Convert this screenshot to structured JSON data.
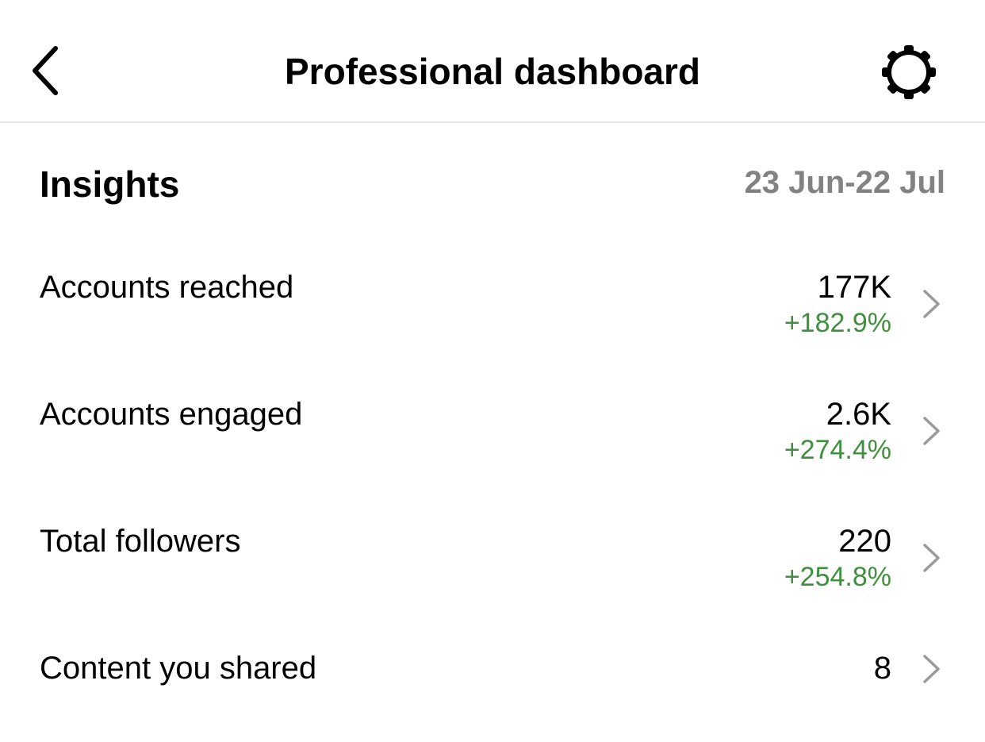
{
  "header": {
    "title": "Professional dashboard",
    "back_icon": "chevron-left-icon",
    "settings_icon": "gear-icon"
  },
  "insights": {
    "title": "Insights",
    "date_range": "23 Jun-22 Jul"
  },
  "metrics": [
    {
      "label": "Accounts reached",
      "value": "177K",
      "change": "+182.9%"
    },
    {
      "label": "Accounts engaged",
      "value": "2.6K",
      "change": "+274.4%"
    },
    {
      "label": "Total followers",
      "value": "220",
      "change": "+254.8%"
    },
    {
      "label": "Content you shared",
      "value": "8"
    }
  ],
  "colors": {
    "positive_change": "#3f8f3f",
    "secondary_text": "#828282",
    "divider": "#e3e3e3",
    "chevron": "#9a9a9a"
  }
}
